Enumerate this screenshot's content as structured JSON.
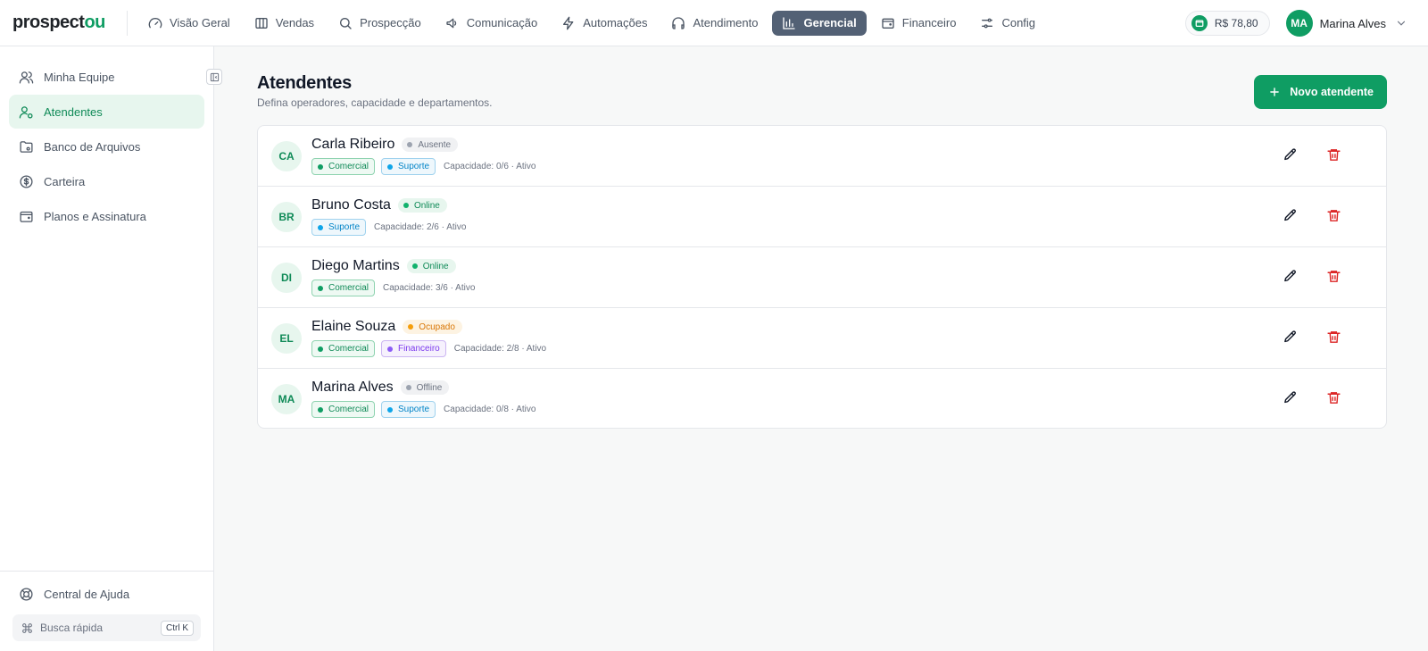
{
  "brand": {
    "logo_main": "prospect",
    "logo_accent": "ou"
  },
  "nav": {
    "items": [
      {
        "label": "Visão Geral",
        "icon": "gauge-icon"
      },
      {
        "label": "Vendas",
        "icon": "building-icon"
      },
      {
        "label": "Prospecção",
        "icon": "search-icon"
      },
      {
        "label": "Comunicação",
        "icon": "megaphone-icon"
      },
      {
        "label": "Automações",
        "icon": "lightning-icon"
      },
      {
        "label": "Atendimento",
        "icon": "headphones-icon"
      },
      {
        "label": "Gerencial",
        "icon": "bar-chart-icon",
        "active": true
      },
      {
        "label": "Financeiro",
        "icon": "wallet-icon"
      },
      {
        "label": "Config",
        "icon": "sliders-icon"
      }
    ]
  },
  "header": {
    "balance": "R$ 78,80",
    "user_initials": "MA",
    "user_name": "Marina Alves"
  },
  "sidebar": {
    "items": [
      {
        "label": "Minha Equipe",
        "icon": "users-icon"
      },
      {
        "label": "Atendentes",
        "icon": "user-cog-icon",
        "active": true
      },
      {
        "label": "Banco de Arquivos",
        "icon": "folder-icon"
      },
      {
        "label": "Carteira",
        "icon": "dollar-circle-icon"
      },
      {
        "label": "Planos e Assinatura",
        "icon": "wallet-icon"
      }
    ],
    "help_label": "Central de Ajuda",
    "quick_search_label": "Busca rápida",
    "quick_search_shortcut": "Ctrl K"
  },
  "page": {
    "title": "Atendentes",
    "subtitle": "Defina operadores, capacidade e departamentos.",
    "new_button_label": "Novo atendente"
  },
  "attendants": [
    {
      "initials": "CA",
      "name": "Carla Ribeiro",
      "status": "Ausente",
      "status_key": "ausente",
      "departments": [
        {
          "label": "Comercial",
          "key": "comercial"
        },
        {
          "label": "Suporte",
          "key": "suporte"
        }
      ],
      "capacity": "Capacidade: 0/6 · Ativo"
    },
    {
      "initials": "BR",
      "name": "Bruno Costa",
      "status": "Online",
      "status_key": "online",
      "departments": [
        {
          "label": "Suporte",
          "key": "suporte"
        }
      ],
      "capacity": "Capacidade: 2/6 · Ativo"
    },
    {
      "initials": "DI",
      "name": "Diego Martins",
      "status": "Online",
      "status_key": "online",
      "departments": [
        {
          "label": "Comercial",
          "key": "comercial"
        }
      ],
      "capacity": "Capacidade: 3/6 · Ativo"
    },
    {
      "initials": "EL",
      "name": "Elaine Souza",
      "status": "Ocupado",
      "status_key": "ocupado",
      "departments": [
        {
          "label": "Comercial",
          "key": "comercial"
        },
        {
          "label": "Financeiro",
          "key": "financeiro"
        }
      ],
      "capacity": "Capacidade: 2/8 · Ativo"
    },
    {
      "initials": "MA",
      "name": "Marina Alves",
      "status": "Offline",
      "status_key": "offline",
      "departments": [
        {
          "label": "Comercial",
          "key": "comercial"
        },
        {
          "label": "Suporte",
          "key": "suporte"
        }
      ],
      "capacity": "Capacidade: 0/8 · Ativo"
    }
  ],
  "colors": {
    "accent": "#0f9d63",
    "nav_active": "#536175",
    "danger": "#dc2626"
  }
}
